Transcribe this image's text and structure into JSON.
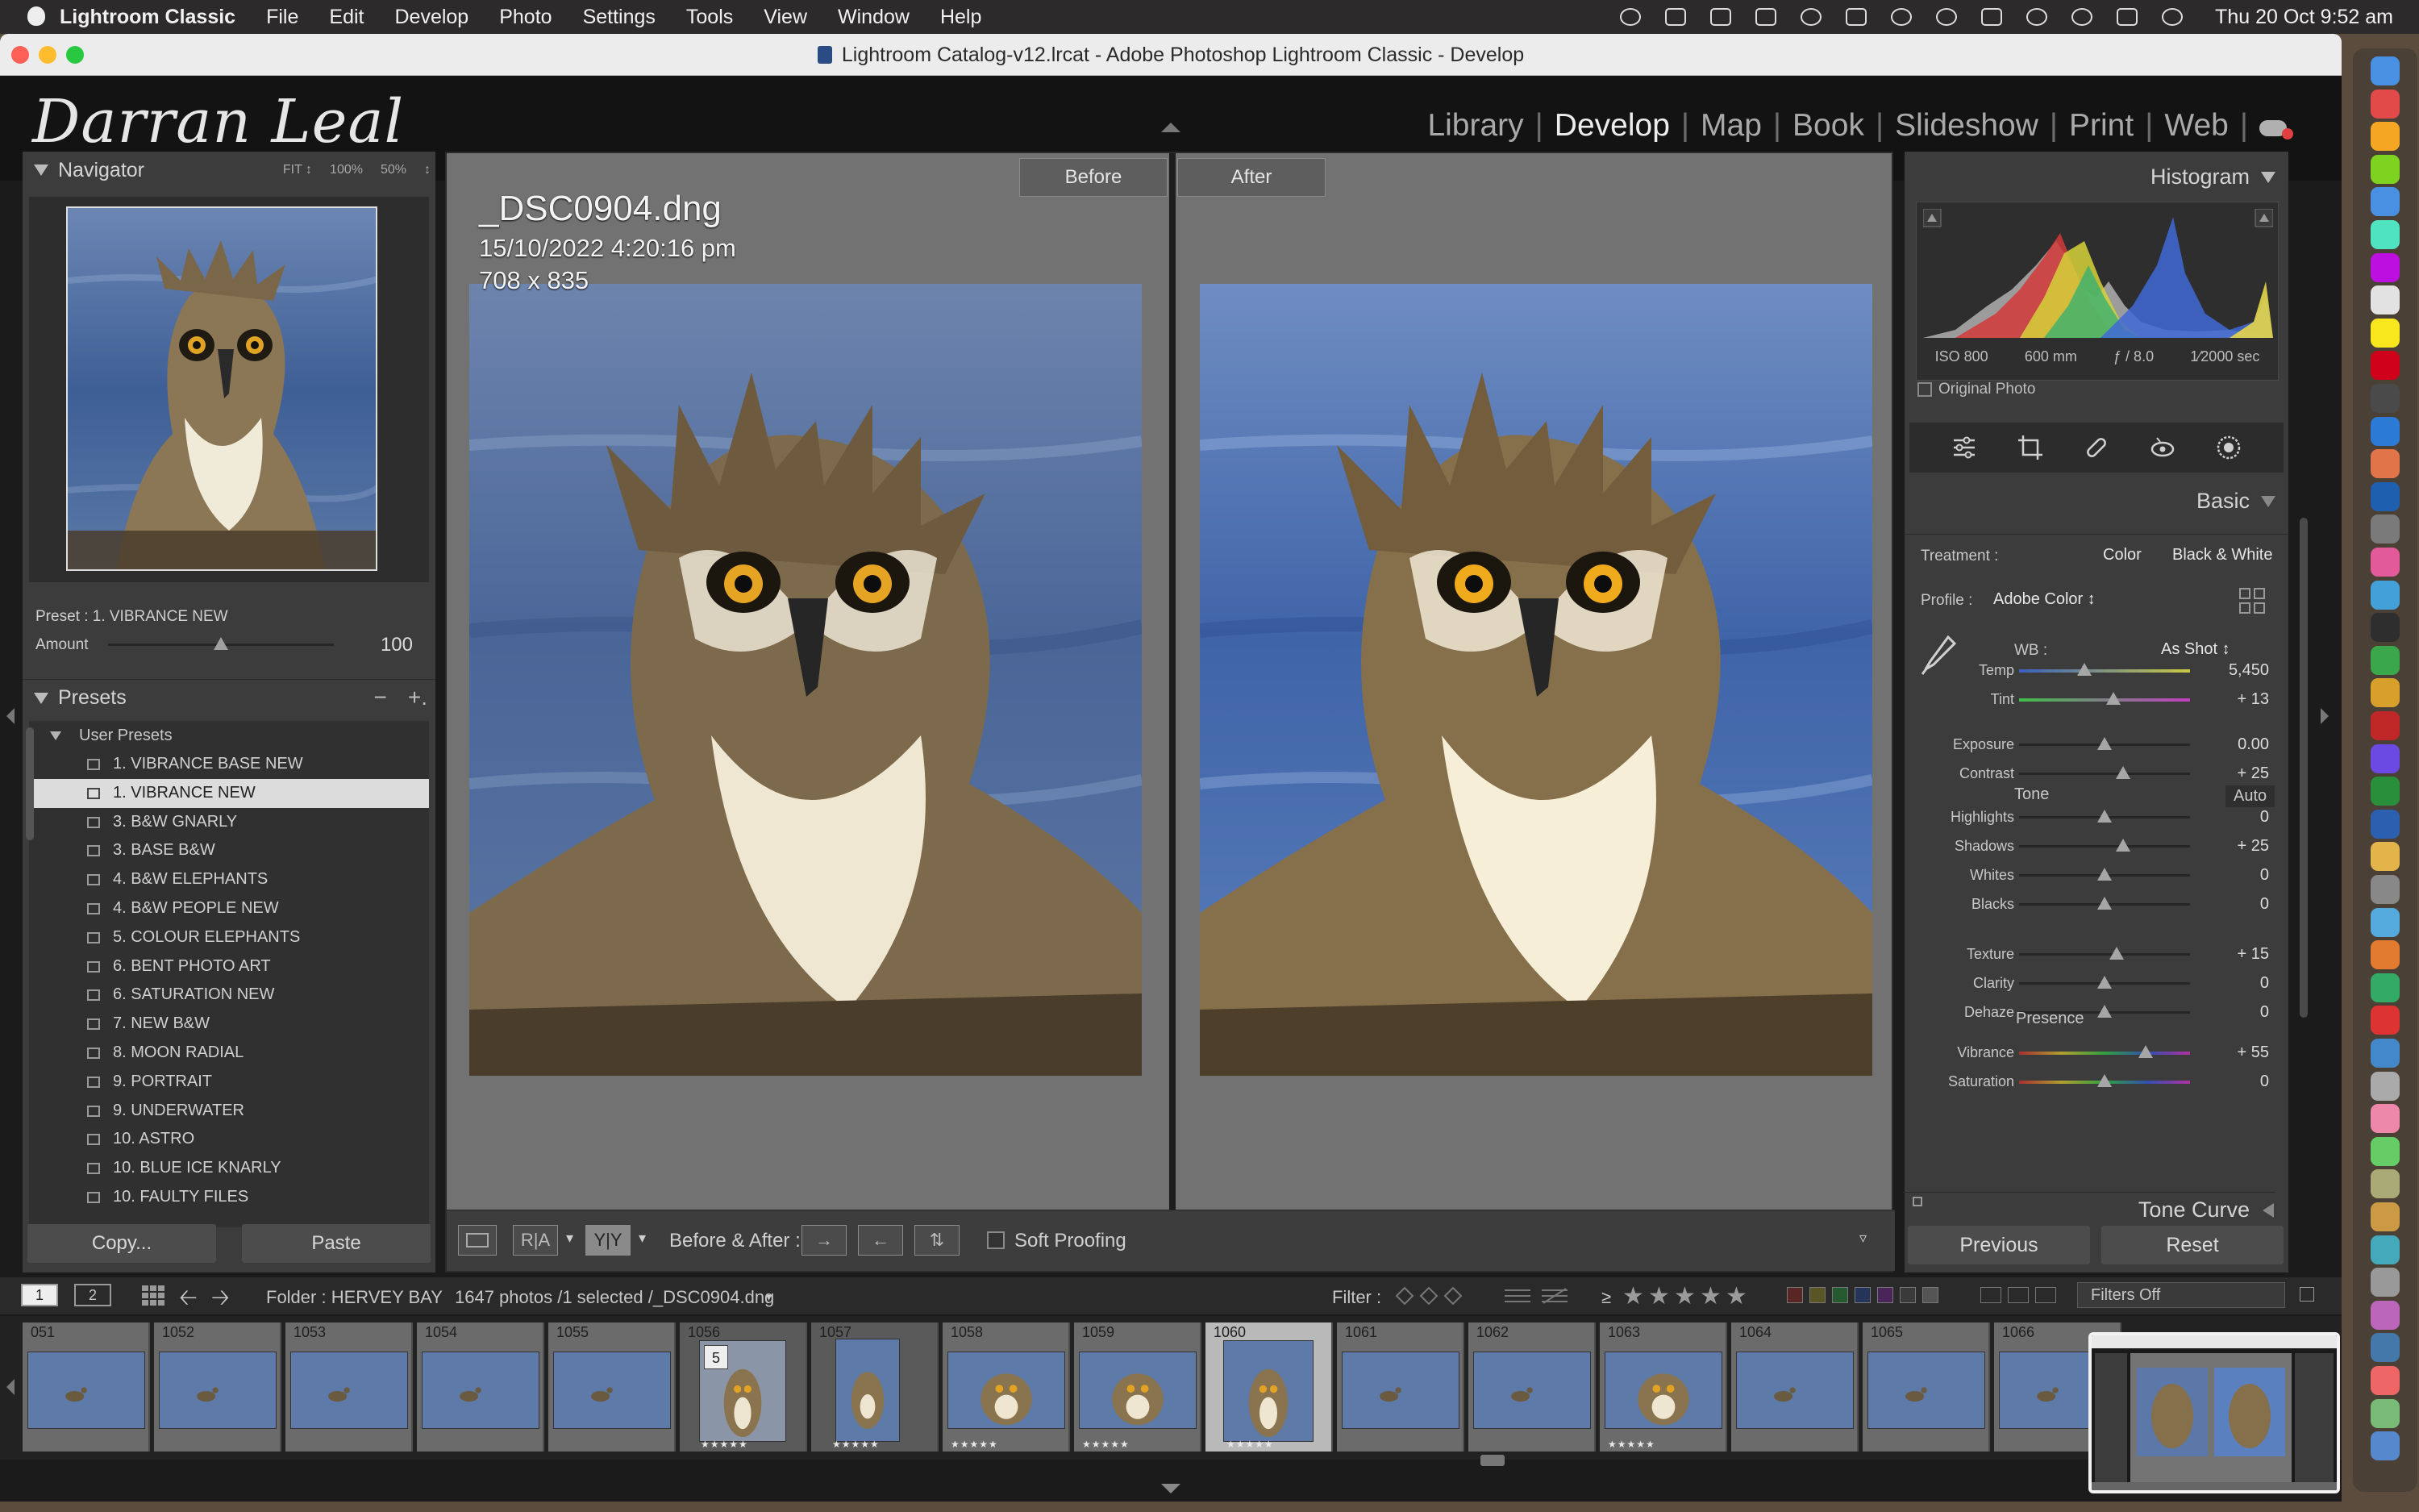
{
  "menubar": {
    "app_name": "Lightroom Classic",
    "items": [
      "File",
      "Edit",
      "Develop",
      "Photo",
      "Settings",
      "Tools",
      "View",
      "Window",
      "Help"
    ],
    "clock": "Thu 20 Oct  9:52 am"
  },
  "window": {
    "title": "Lightroom Catalog-v12.lrcat - Adobe Photoshop Lightroom Classic - Develop"
  },
  "identity_plate": "Darran Leal",
  "modules": [
    "Library",
    "Develop",
    "Map",
    "Book",
    "Slideshow",
    "Print",
    "Web"
  ],
  "active_module": "Develop",
  "navigator": {
    "title": "Navigator",
    "zoom": [
      "FIT ↕",
      "100%",
      "50%",
      "↕"
    ]
  },
  "preset_amount": {
    "preset_label": "Preset : 1. VIBRANCE NEW",
    "amount_label": "Amount",
    "amount_value": "100",
    "amount_fraction": 0.5
  },
  "presets": {
    "title": "Presets",
    "minus": "−",
    "plus": "+.",
    "group": "User Presets",
    "items": [
      "1. VIBRANCE BASE NEW",
      "1. VIBRANCE NEW",
      "3. B&W GNARLY",
      "3. BASE B&W",
      "4. B&W ELEPHANTS",
      "4. B&W PEOPLE NEW",
      "5. COLOUR ELEPHANTS",
      "6. BENT PHOTO ART",
      "6. SATURATION NEW",
      "7. NEW B&W",
      "8. MOON RADIAL",
      "9. PORTRAIT",
      "9. UNDERWATER",
      "10. ASTRO",
      "10. BLUE ICE KNARLY",
      "10. FAULTY FILES"
    ],
    "selected_index": 1
  },
  "left_buttons": {
    "copy": "Copy...",
    "paste": "Paste"
  },
  "view": {
    "before_label": "Before",
    "after_label": "After",
    "filename": "_DSC0904.dng",
    "datetime": "15/10/2022 4:20:16 pm",
    "dimensions": "708 x 835"
  },
  "toolbar": {
    "ra": "R|A",
    "yy": "Y|Y",
    "before_after_label": "Before & After :",
    "soft_proofing": "Soft Proofing",
    "arrow1": "→",
    "arrow2": "←",
    "arrow3": "⇅"
  },
  "histogram": {
    "title": "Histogram",
    "iso": "ISO 800",
    "focal": "600 mm",
    "aperture": "ƒ / 8.0",
    "shutter": "1⁄2000 sec",
    "original_photo": "Original Photo"
  },
  "basic": {
    "title": "Basic",
    "treatment_label": "Treatment :",
    "treatment_color": "Color",
    "treatment_bw": "Black & White",
    "profile_label": "Profile :",
    "profile_value": "Adobe Color ↕",
    "wb_label": "WB :",
    "wb_value": "As Shot ↕",
    "tone_label": "Tone",
    "auto_label": "Auto",
    "presence_label": "Presence",
    "sliders": [
      {
        "name": "Temp",
        "value": "5,450",
        "pos": 0.38
      },
      {
        "name": "Tint",
        "value": "+ 13",
        "pos": 0.55
      },
      {
        "name": "Exposure",
        "value": "0.00",
        "pos": 0.5
      },
      {
        "name": "Contrast",
        "value": "+ 25",
        "pos": 0.61
      },
      {
        "name": "Highlights",
        "value": "0",
        "pos": 0.5
      },
      {
        "name": "Shadows",
        "value": "+ 25",
        "pos": 0.61
      },
      {
        "name": "Whites",
        "value": "0",
        "pos": 0.5
      },
      {
        "name": "Blacks",
        "value": "0",
        "pos": 0.5
      },
      {
        "name": "Texture",
        "value": "+ 15",
        "pos": 0.57
      },
      {
        "name": "Clarity",
        "value": "0",
        "pos": 0.5
      },
      {
        "name": "Dehaze",
        "value": "0",
        "pos": 0.5
      },
      {
        "name": "Vibrance",
        "value": "+ 55",
        "pos": 0.74
      },
      {
        "name": "Saturation",
        "value": "0",
        "pos": 0.5
      }
    ]
  },
  "tone_curve": "Tone Curve",
  "right_buttons": {
    "previous": "Previous",
    "reset": "Reset"
  },
  "filmstrip_bar": {
    "monitor1": "1",
    "monitor2": "2",
    "folder": "Folder : HERVEY BAY",
    "count": "1647 photos /1 selected /_DSC0904.dng",
    "filter_label": "Filter :",
    "gte": "≥",
    "filters_off": "Filters Off"
  },
  "filmstrip": {
    "cells": [
      "051",
      "1052",
      "1053",
      "1054",
      "1055",
      "1056",
      "1057",
      "1058",
      "1059",
      "1060",
      "1061",
      "1062",
      "1063",
      "1064",
      "1065",
      "1066"
    ],
    "selected": "1060",
    "stars": "★★★★★",
    "badge": "5"
  },
  "colors": {
    "panel": "#3c3c3c",
    "background": "#727272",
    "selected_preset": "#dcdcdc"
  }
}
